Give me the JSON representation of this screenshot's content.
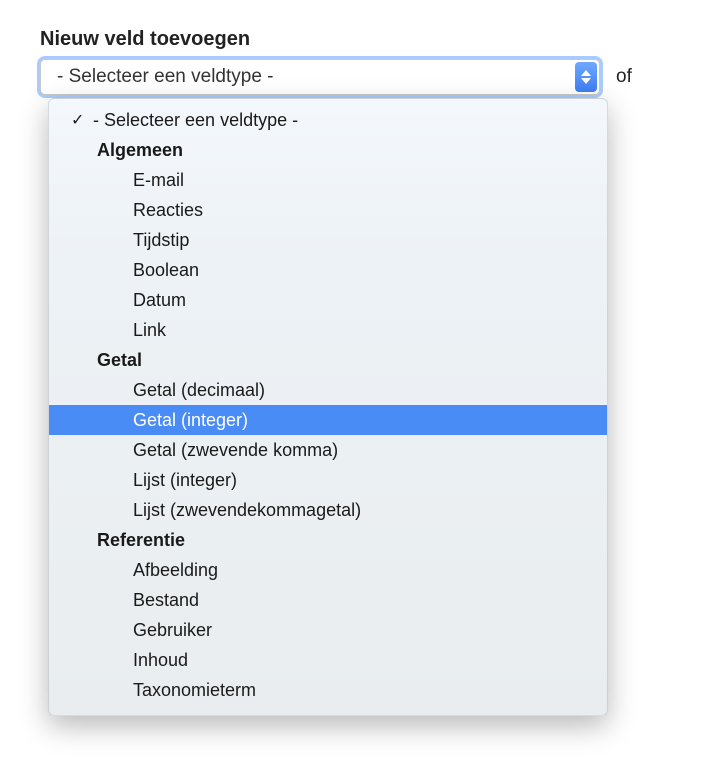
{
  "title": "Nieuw veld toevoegen",
  "select": {
    "placeholder": "- Selecteer een veldtype -",
    "suffix_label": "of"
  },
  "dropdown": {
    "placeholder_option": "- Selecteer een veldtype -",
    "groups": [
      {
        "label": "Algemeen",
        "items": [
          "E-mail",
          "Reacties",
          "Tijdstip",
          "Boolean",
          "Datum",
          "Link"
        ]
      },
      {
        "label": "Getal",
        "items": [
          "Getal (decimaal)",
          "Getal (integer)",
          "Getal (zwevende komma)",
          "Lijst (integer)",
          "Lijst (zwevendekommagetal)"
        ]
      },
      {
        "label": "Referentie",
        "items": [
          "Afbeelding",
          "Bestand",
          "Gebruiker",
          "Inhoud",
          "Taxonomieterm"
        ]
      }
    ],
    "highlighted": "Getal (integer)",
    "checked": "- Selecteer een veldtype -"
  }
}
